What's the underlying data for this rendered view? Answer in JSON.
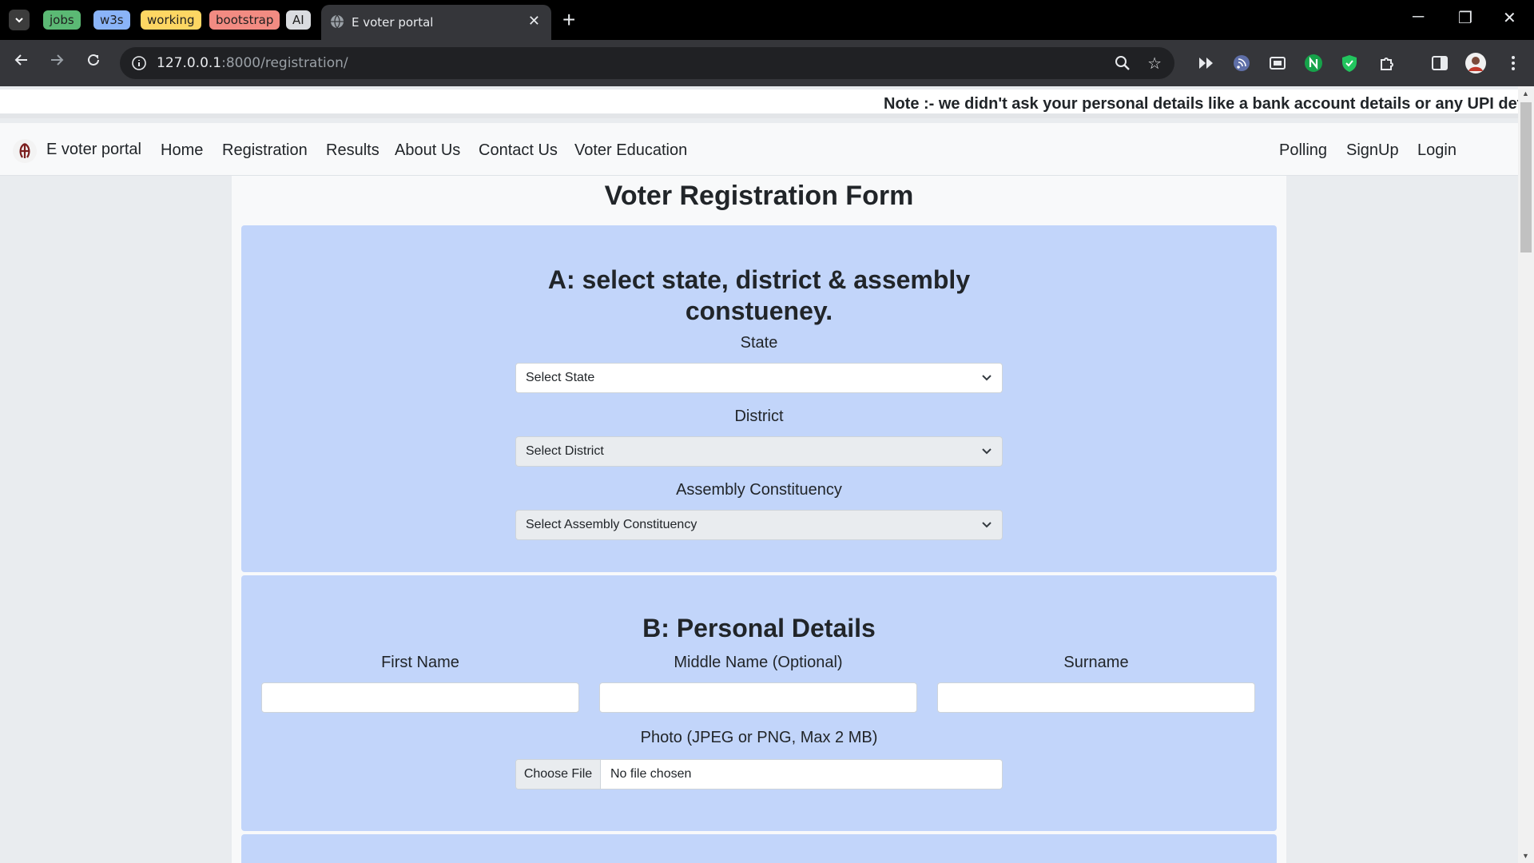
{
  "browser": {
    "tab_groups": [
      {
        "label": "jobs",
        "color": "#5bb974"
      },
      {
        "label": "w3s",
        "color": "#8ab4f8"
      },
      {
        "label": "working",
        "color": "#fdd663"
      },
      {
        "label": "bootstrap",
        "color": "#f28b82"
      },
      {
        "label": "AI",
        "color": "#dadce0"
      }
    ],
    "active_tab_title": "E voter portal",
    "url_host": "127.0.0.1",
    "url_rest": ":8000/registration/"
  },
  "marquee": {
    "note": "Note :- we didn't ask your personal details like a bank account details or any UPI details"
  },
  "navbar": {
    "brand": "E voter portal",
    "left_links": [
      "Home",
      "Registration",
      "Results",
      "About Us",
      "Contact Us",
      "Voter Education"
    ],
    "right_links": [
      "Polling",
      "SignUp",
      "Login"
    ]
  },
  "form": {
    "title": "Voter Registration Form",
    "section_a": {
      "heading_line1": "A: select state, district & assembly",
      "heading_line2": "constueney.",
      "state_label": "State",
      "state_value": "Select State",
      "district_label": "District",
      "district_value": "Select District",
      "assembly_label": "Assembly Constituency",
      "assembly_value": "Select Assembly Constituency"
    },
    "section_b": {
      "heading": "B: Personal Details",
      "first_name_label": "First Name",
      "middle_name_label": "Middle Name (Optional)",
      "surname_label": "Surname",
      "photo_label": "Photo (JPEG or PNG, Max 2 MB)",
      "choose_file": "Choose File",
      "file_status": "No file chosen"
    }
  }
}
